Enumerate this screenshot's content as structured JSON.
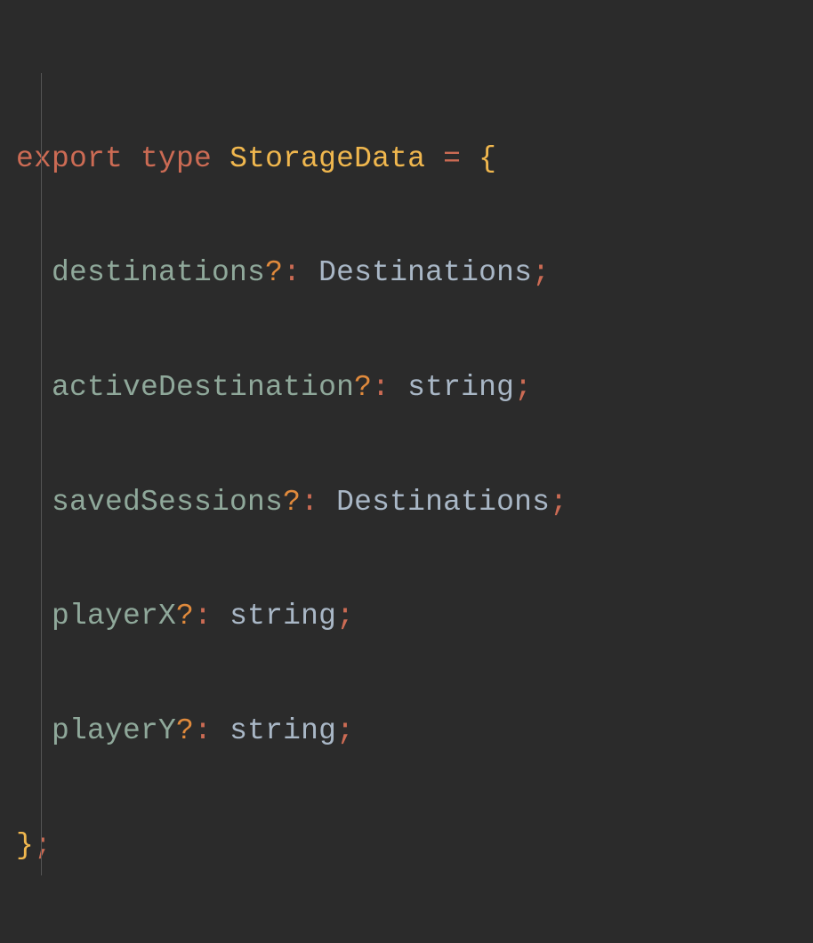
{
  "code": {
    "line1": {
      "kw_export": "export",
      "kw_type": "type",
      "typename": "StorageData",
      "eq": "=",
      "open_brace": "{"
    },
    "props": [
      {
        "name": "destinations",
        "q": "?",
        "colon": ":",
        "type": "Destinations",
        "semi": ";"
      },
      {
        "name": "activeDestination",
        "q": "?",
        "colon": ":",
        "type": "string",
        "semi": ";"
      },
      {
        "name": "savedSessions",
        "q": "?",
        "colon": ":",
        "type": "Destinations",
        "semi": ";"
      },
      {
        "name": "playerX",
        "q": "?",
        "colon": ":",
        "type": "string",
        "semi": ";"
      },
      {
        "name": "playerY",
        "q": "?",
        "colon": ":",
        "type": "string",
        "semi": ";"
      }
    ],
    "close": {
      "close_brace": "}",
      "close_semi": ";"
    }
  }
}
